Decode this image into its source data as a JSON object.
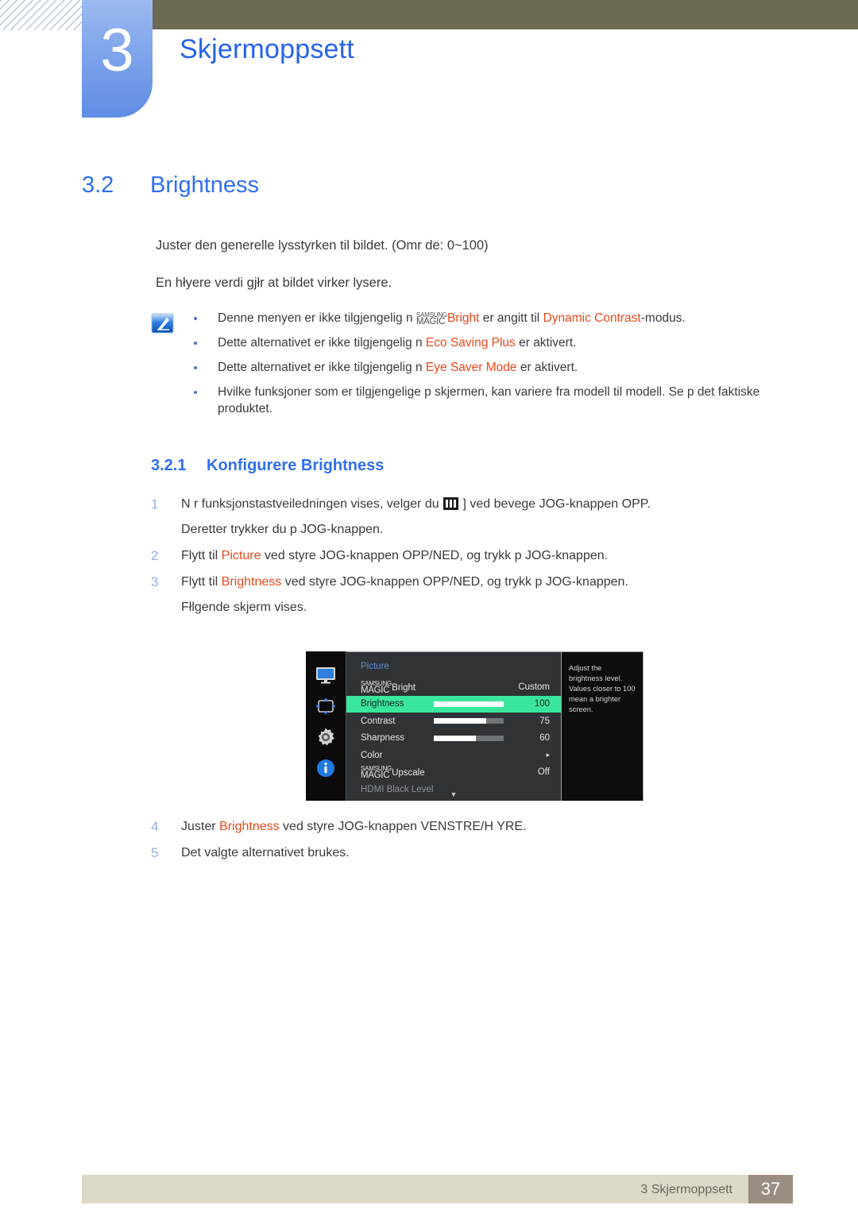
{
  "header": {
    "chapter_number": "3",
    "chapter_title": "Skjermoppsett"
  },
  "section": {
    "number": "3.2",
    "title": "Brightness"
  },
  "intro": {
    "paragraph1": "Juster den generelle lysstyrken til bildet. (Omr de: 0~100)",
    "paragraph2": "En hłyere verdi gjłr at bildet virker lysere."
  },
  "note": {
    "icon": "note-pencil-icon",
    "bullets": [
      {
        "pre": "Denne menyen er ikke tilgjengelig n ",
        "logo_line1": "SAMSUNG",
        "logo_line2": "MAGIC",
        "hl1": "Bright",
        "mid": " er angitt til ",
        "hl2": "Dynamic Contrast",
        "post": "-modus."
      },
      {
        "pre": "Dette alternativet er ikke tilgjengelig n ",
        "hl1": "Eco Saving Plus",
        "post": " er aktivert."
      },
      {
        "pre": "Dette alternativet er ikke tilgjengelig n ",
        "hl1": "Eye Saver Mode",
        "post": " er aktivert."
      },
      {
        "pre": "Hvilke funksjoner som er tilgjengelige p  skjermen, kan variere fra modell til modell. Se p  det faktiske produktet."
      }
    ]
  },
  "subsection": {
    "number": "3.2.1",
    "title": "Konfigurere Brightness"
  },
  "steps_before": [
    {
      "num": "1",
      "pre": "N r funksjonstastveiledningen vises, velger du ",
      "icon": "menu-bars-icon",
      "post": " ] ved   bevege JOG-knappen OPP.",
      "subline": "Deretter trykker du p  JOG-knappen."
    },
    {
      "num": "2",
      "pre": "Flytt til ",
      "hl1": "Picture",
      "post": " ved   styre JOG-knappen OPP/NED, og trykk p  JOG-knappen."
    },
    {
      "num": "3",
      "pre": "Flytt til ",
      "hl1": "Brightness",
      "post": " ved   styre JOG-knappen OPP/NED, og trykk p  JOG-knappen.",
      "subline": "Fłlgende skjerm vises."
    }
  ],
  "steps_after": [
    {
      "num": "4",
      "pre": "Juster ",
      "hl1": "Brightness",
      "post": " ved   styre JOG-knappen VENSTRE/H YRE."
    },
    {
      "num": "5",
      "pre": "Det valgte alternativet brukes."
    }
  ],
  "osd": {
    "title": "Picture",
    "sidebar_icons": [
      "monitor-display-icon",
      "screen-adjust-icon",
      "settings-gear-icon",
      "information-icon"
    ],
    "rows": [
      {
        "label": "Bright",
        "logo_line1": "SAMSUNG",
        "logo_line2": "MAGIC",
        "value": "Custom",
        "type": "value",
        "selected": false,
        "dim": false
      },
      {
        "label": "Brightness",
        "value": "100",
        "type": "slider",
        "slider_percent": 100,
        "selected": true,
        "dim": false
      },
      {
        "label": "Contrast",
        "value": "75",
        "type": "slider",
        "slider_percent": 75,
        "selected": false,
        "dim": false
      },
      {
        "label": "Sharpness",
        "value": "60",
        "type": "slider",
        "slider_percent": 60,
        "selected": false,
        "dim": false
      },
      {
        "label": "Color",
        "value": "▸",
        "type": "submenu",
        "selected": false,
        "dim": false
      },
      {
        "label": "Upscale",
        "logo_line1": "SAMSUNG",
        "logo_line2": "MAGIC",
        "value": "Off",
        "type": "value",
        "selected": false,
        "dim": false
      },
      {
        "label": "HDMI Black Level",
        "value": "",
        "type": "value",
        "selected": false,
        "dim": true
      }
    ],
    "scroll_indicator": "▼",
    "tooltip": "Adjust the brightness level. Values closer to 100 mean a brighter screen."
  },
  "footer": {
    "text": "3 Skjermoppsett",
    "page": "37"
  },
  "colors": {
    "accent_blue": "#2f6ff0",
    "highlight_orange": "#e8491b",
    "osd_selected_green": "#3ae69b",
    "olive_bar": "#6d6a52",
    "footer_beige": "#ddd9c7",
    "footer_page_box": "#9b8e80"
  }
}
